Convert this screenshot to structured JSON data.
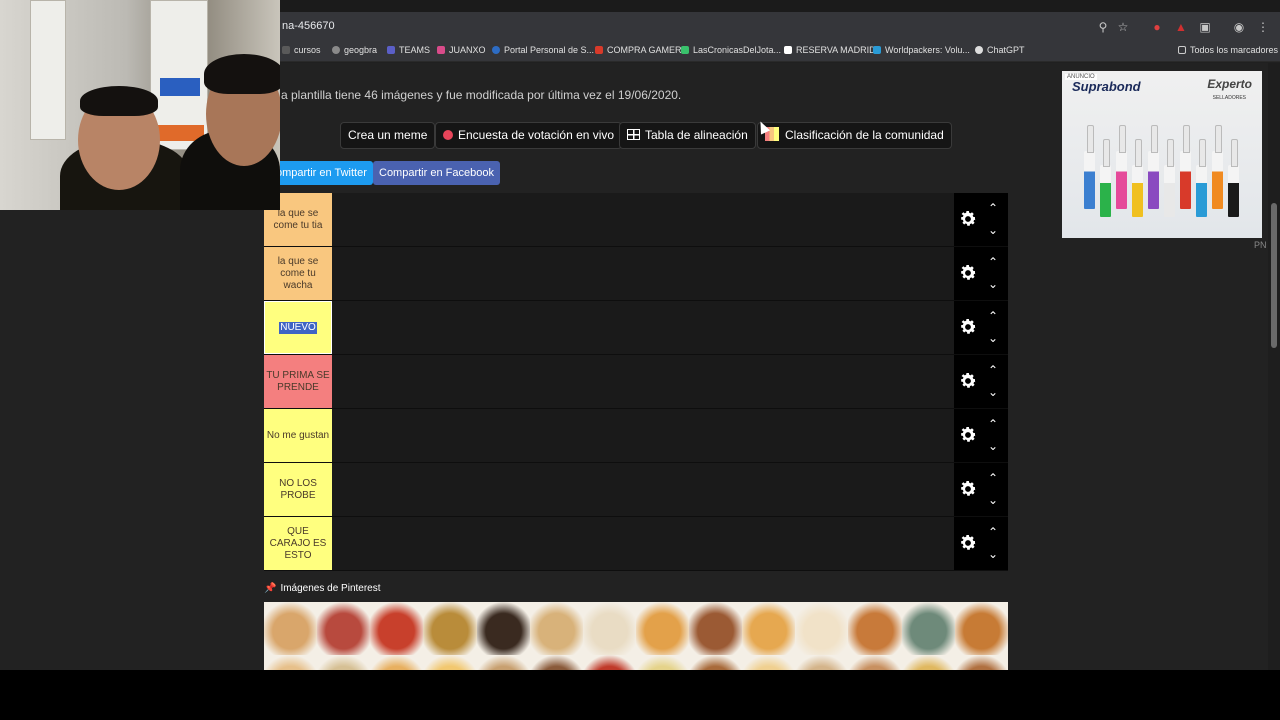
{
  "browser": {
    "url": "na-456670",
    "bookmarks": [
      {
        "label": "cursos",
        "color": "#5a5a5a"
      },
      {
        "label": "geogbra",
        "color": "#8a8a8a"
      },
      {
        "label": "TEAMS",
        "color": "#5b5fc7"
      },
      {
        "label": "JUANXO",
        "color": "#d94b8a"
      },
      {
        "label": "Portal Personal de S...",
        "color": "#2d6cc4"
      },
      {
        "label": "COMPRA GAMER",
        "color": "#d83a2a"
      },
      {
        "label": "LasCronicasDelJota...",
        "color": "#39c16c"
      },
      {
        "label": "RESERVA MADRID",
        "color": "#ffffff"
      },
      {
        "label": "Worldpackers: Volu...",
        "color": "#2a9bd6"
      },
      {
        "label": "ChatGPT",
        "color": "#dddddd"
      }
    ],
    "all_bookmarks_label": "Todos los marcadores"
  },
  "page": {
    "info_text": "a plantilla tiene 46 imágenes y fue modificada por última vez el 19/06/2020.",
    "buttons": {
      "create_meme": "Crea un meme",
      "live_poll": "Encuesta de votación en vivo",
      "alignment_chart": "Tabla de alineación",
      "community_ranking": "Clasificación de la comunidad"
    },
    "share": {
      "twitter": "ompartir en Twitter",
      "facebook": "Compartir en Facebook"
    },
    "tiers": [
      {
        "label": "la que se come tu tia",
        "color": "#f9c77f"
      },
      {
        "label": "la que se come tu wacha",
        "color": "#f9c77f"
      },
      {
        "label": "NUEVO",
        "color": "#ffff7f",
        "selected": true
      },
      {
        "label": "TU PRIMA SE PRENDE",
        "color": "#f47f7f"
      },
      {
        "label": "No me gustan",
        "color": "#ffff7f"
      },
      {
        "label": "NO LOS PROBE",
        "color": "#ffff7f"
      },
      {
        "label": "QUE CARAJO ES ESTO",
        "color": "#ffff7f"
      }
    ],
    "pinterest_title": "Imágenes de Pinterest",
    "thumbnail_colors": [
      "#d9a66b",
      "#b84a3e",
      "#c8402c",
      "#b98c3a",
      "#3a2a20",
      "#d8b27a",
      "#e9dcc4",
      "#e3a14a",
      "#9b5a34",
      "#e6a850",
      "#f1e2c8",
      "#c87a3a",
      "#6e8a7a",
      "#c77b35",
      "#e7c08a",
      "#d6c094",
      "#e8b060",
      "#f2c870",
      "#c8a070",
      "#8a5a3a",
      "#c03a2a",
      "#e5d38a",
      "#a86a3a",
      "#f0d090",
      "#d4b48a",
      "#c89060",
      "#e0b860",
      "#b07040"
    ]
  },
  "ad": {
    "badge": "ANUNCIO",
    "brand": "Suprabond",
    "expert": "Experto",
    "sub": "SELLADORES",
    "tube_colors": [
      "#3b7fd0",
      "#2bb24a",
      "#e54a9a",
      "#f0c020",
      "#8a4ac0",
      "#e8e8e8",
      "#d83a2a",
      "#2a9bd6",
      "#f08a20",
      "#1a1a1a"
    ],
    "corner": "PN"
  }
}
